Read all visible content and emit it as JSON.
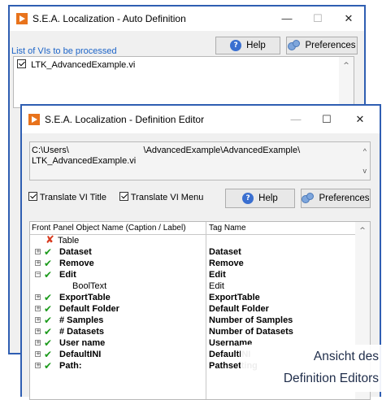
{
  "auto_window": {
    "title": "S.E.A. Localization - Auto Definition",
    "controls": {
      "minimize": "—",
      "maximize": "☐",
      "close": "✕"
    },
    "help_label": "Help",
    "preferences_label": "Preferences",
    "vis_list_label": "List of VIs to be processed",
    "vis": [
      {
        "name": "LTK_AdvancedExample.vi",
        "checked": true
      }
    ]
  },
  "editor_window": {
    "title": "S.E.A. Localization -  Definition Editor",
    "controls": {
      "minimize": "—",
      "maximize": "☐",
      "close": "✕"
    },
    "path_line1": "C:\\Users\\                              \\AdvancedExample\\AdvancedExample\\",
    "path_line2": "LTK_AdvancedExample.vi",
    "translate_title_label": "Translate VI Title",
    "translate_menu_label": "Translate VI Menu",
    "help_label": "Help",
    "preferences_label": "Preferences",
    "table": {
      "header_name": "Front Panel Object Name (Caption / Label)",
      "header_tag": "Tag Name",
      "rows": [
        {
          "name": "Table",
          "tag": "",
          "status": "cross",
          "expander": "",
          "indent": 1,
          "bold": false
        },
        {
          "name": "Dataset",
          "tag": "Dataset",
          "status": "check",
          "expander": "+",
          "indent": 0,
          "bold": true
        },
        {
          "name": "Remove",
          "tag": "Remove",
          "status": "check",
          "expander": "+",
          "indent": 0,
          "bold": true
        },
        {
          "name": "Edit",
          "tag": "Edit",
          "status": "check",
          "expander": "−",
          "indent": 0,
          "bold": true
        },
        {
          "name": "BoolText",
          "tag": "Edit",
          "status": "",
          "expander": "",
          "indent": 2,
          "bold": false
        },
        {
          "name": "ExportTable",
          "tag": "ExportTable",
          "status": "check",
          "expander": "+",
          "indent": 0,
          "bold": true
        },
        {
          "name": "Default Folder",
          "tag": "Default Folder",
          "status": "check",
          "expander": "+",
          "indent": 0,
          "bold": true
        },
        {
          "name": "# Samples",
          "tag": "Number of Samples",
          "status": "check",
          "expander": "+",
          "indent": 0,
          "bold": true
        },
        {
          "name": "# Datasets",
          "tag": "Number of Datasets",
          "status": "check",
          "expander": "+",
          "indent": 0,
          "bold": true
        },
        {
          "name": "User name",
          "tag": "Username",
          "status": "check",
          "expander": "+",
          "indent": 0,
          "bold": true
        },
        {
          "name": "DefaultINI",
          "tag": "DefaultINI",
          "status": "check",
          "expander": "+",
          "indent": 0,
          "bold": true
        },
        {
          "name": "Path:",
          "tag": "Pathsetting",
          "status": "check",
          "expander": "+",
          "indent": 0,
          "bold": true
        }
      ]
    }
  },
  "caption": {
    "line1": "Ansicht des",
    "line2": "Definition Editors"
  },
  "colors": {
    "window_border": "#2f5eb2",
    "accent_orange": "#e8731c",
    "link_blue": "#1c64c8",
    "check_green": "#1a9a1a",
    "cross_red": "#d83b1f",
    "caption_text": "#1f2d4a"
  }
}
